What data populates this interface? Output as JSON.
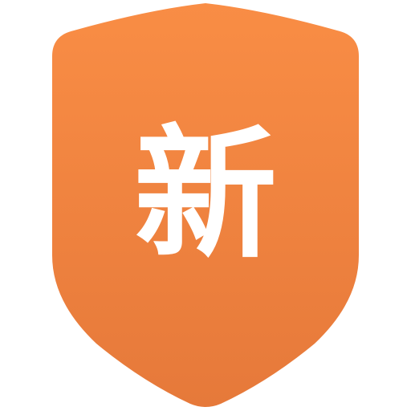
{
  "icon": {
    "name": "shield-icon",
    "character": "新",
    "colors": {
      "gradient_top": "#F98D45",
      "gradient_bottom": "#E6793A",
      "text": "#FFFFFF"
    }
  }
}
